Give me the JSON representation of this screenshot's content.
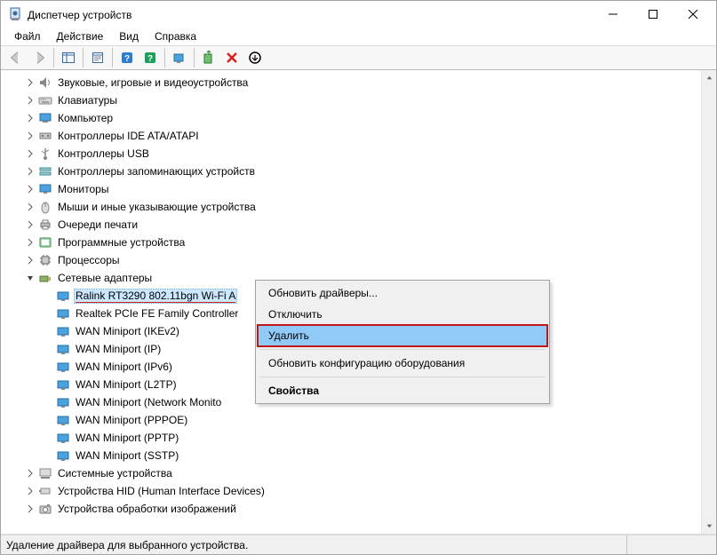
{
  "window": {
    "title": "Диспетчер устройств"
  },
  "menu": {
    "file": "Файл",
    "action": "Действие",
    "view": "Вид",
    "help": "Справка"
  },
  "tree": {
    "c0": "Звуковые, игровые и видеоустройства",
    "c1": "Клавиатуры",
    "c2": "Компьютер",
    "c3": "Контроллеры IDE ATA/ATAPI",
    "c4": "Контроллеры USB",
    "c5": "Контроллеры запоминающих устройств",
    "c6": "Мониторы",
    "c7": "Мыши и иные указывающие устройства",
    "c8": "Очереди печати",
    "c9": "Программные устройства",
    "c10": "Процессоры",
    "c11": "Сетевые адаптеры",
    "c12": "Системные устройства",
    "c13": "Устройства HID (Human Interface Devices)",
    "c14": "Устройства обработки изображений",
    "na0": "Ralink RT3290 802.11bgn Wi-Fi A",
    "na1": "Realtek PCIe FE Family Controller",
    "na2": "WAN Miniport (IKEv2)",
    "na3": "WAN Miniport (IP)",
    "na4": "WAN Miniport (IPv6)",
    "na5": "WAN Miniport (L2TP)",
    "na6": "WAN Miniport (Network Monito",
    "na7": "WAN Miniport (PPPOE)",
    "na8": "WAN Miniport (PPTP)",
    "na9": "WAN Miniport (SSTP)"
  },
  "context_menu": {
    "update": "Обновить драйверы...",
    "disable": "Отключить",
    "delete": "Удалить",
    "scan": "Обновить конфигурацию оборудования",
    "props": "Свойства"
  },
  "status": {
    "text": "Удаление драйвера для выбранного устройства."
  }
}
